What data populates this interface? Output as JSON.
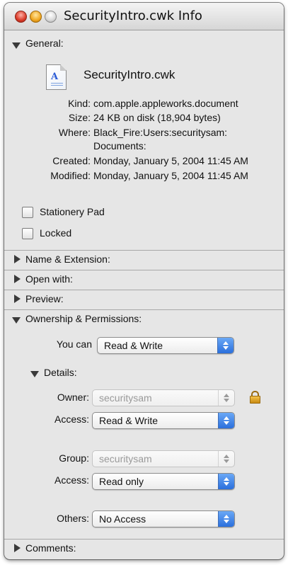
{
  "window": {
    "title": "SecurityIntro.cwk Info"
  },
  "general": {
    "header": "General:",
    "file_name": "SecurityIntro.cwk",
    "kind_label": "Kind:",
    "kind_value": "com.apple.appleworks.document",
    "size_label": "Size:",
    "size_value": "24 KB on disk (18,904 bytes)",
    "where_label": "Where:",
    "where_value_line1": "Black_Fire:Users:securitysam:",
    "where_value_line2": "Documents:",
    "created_label": "Created:",
    "created_value": "Monday, January 5, 2004 11:45 AM",
    "modified_label": "Modified:",
    "modified_value": "Monday, January 5, 2004 11:45 AM",
    "stationery_label": "Stationery Pad",
    "locked_label": "Locked"
  },
  "sections": {
    "name_ext": "Name & Extension:",
    "open_with": "Open with:",
    "preview": "Preview:",
    "ownership": "Ownership & Permissions:",
    "comments": "Comments:"
  },
  "permissions": {
    "you_can_label": "You can",
    "you_can_value": "Read & Write",
    "details_label": "Details:",
    "owner_label": "Owner:",
    "owner_value": "securitysam",
    "owner_access_label": "Access:",
    "owner_access_value": "Read & Write",
    "group_label": "Group:",
    "group_value": "securitysam",
    "group_access_label": "Access:",
    "group_access_value": "Read only",
    "others_label": "Others:",
    "others_value": "No Access"
  },
  "icons": {
    "file": "appleworks-document-icon",
    "lock": "lock-icon"
  },
  "colors": {
    "popup_accent": "#2b6fdc",
    "close_button": "#d93a28",
    "minimize_button": "#f0a620",
    "lock": "#e0a020"
  }
}
